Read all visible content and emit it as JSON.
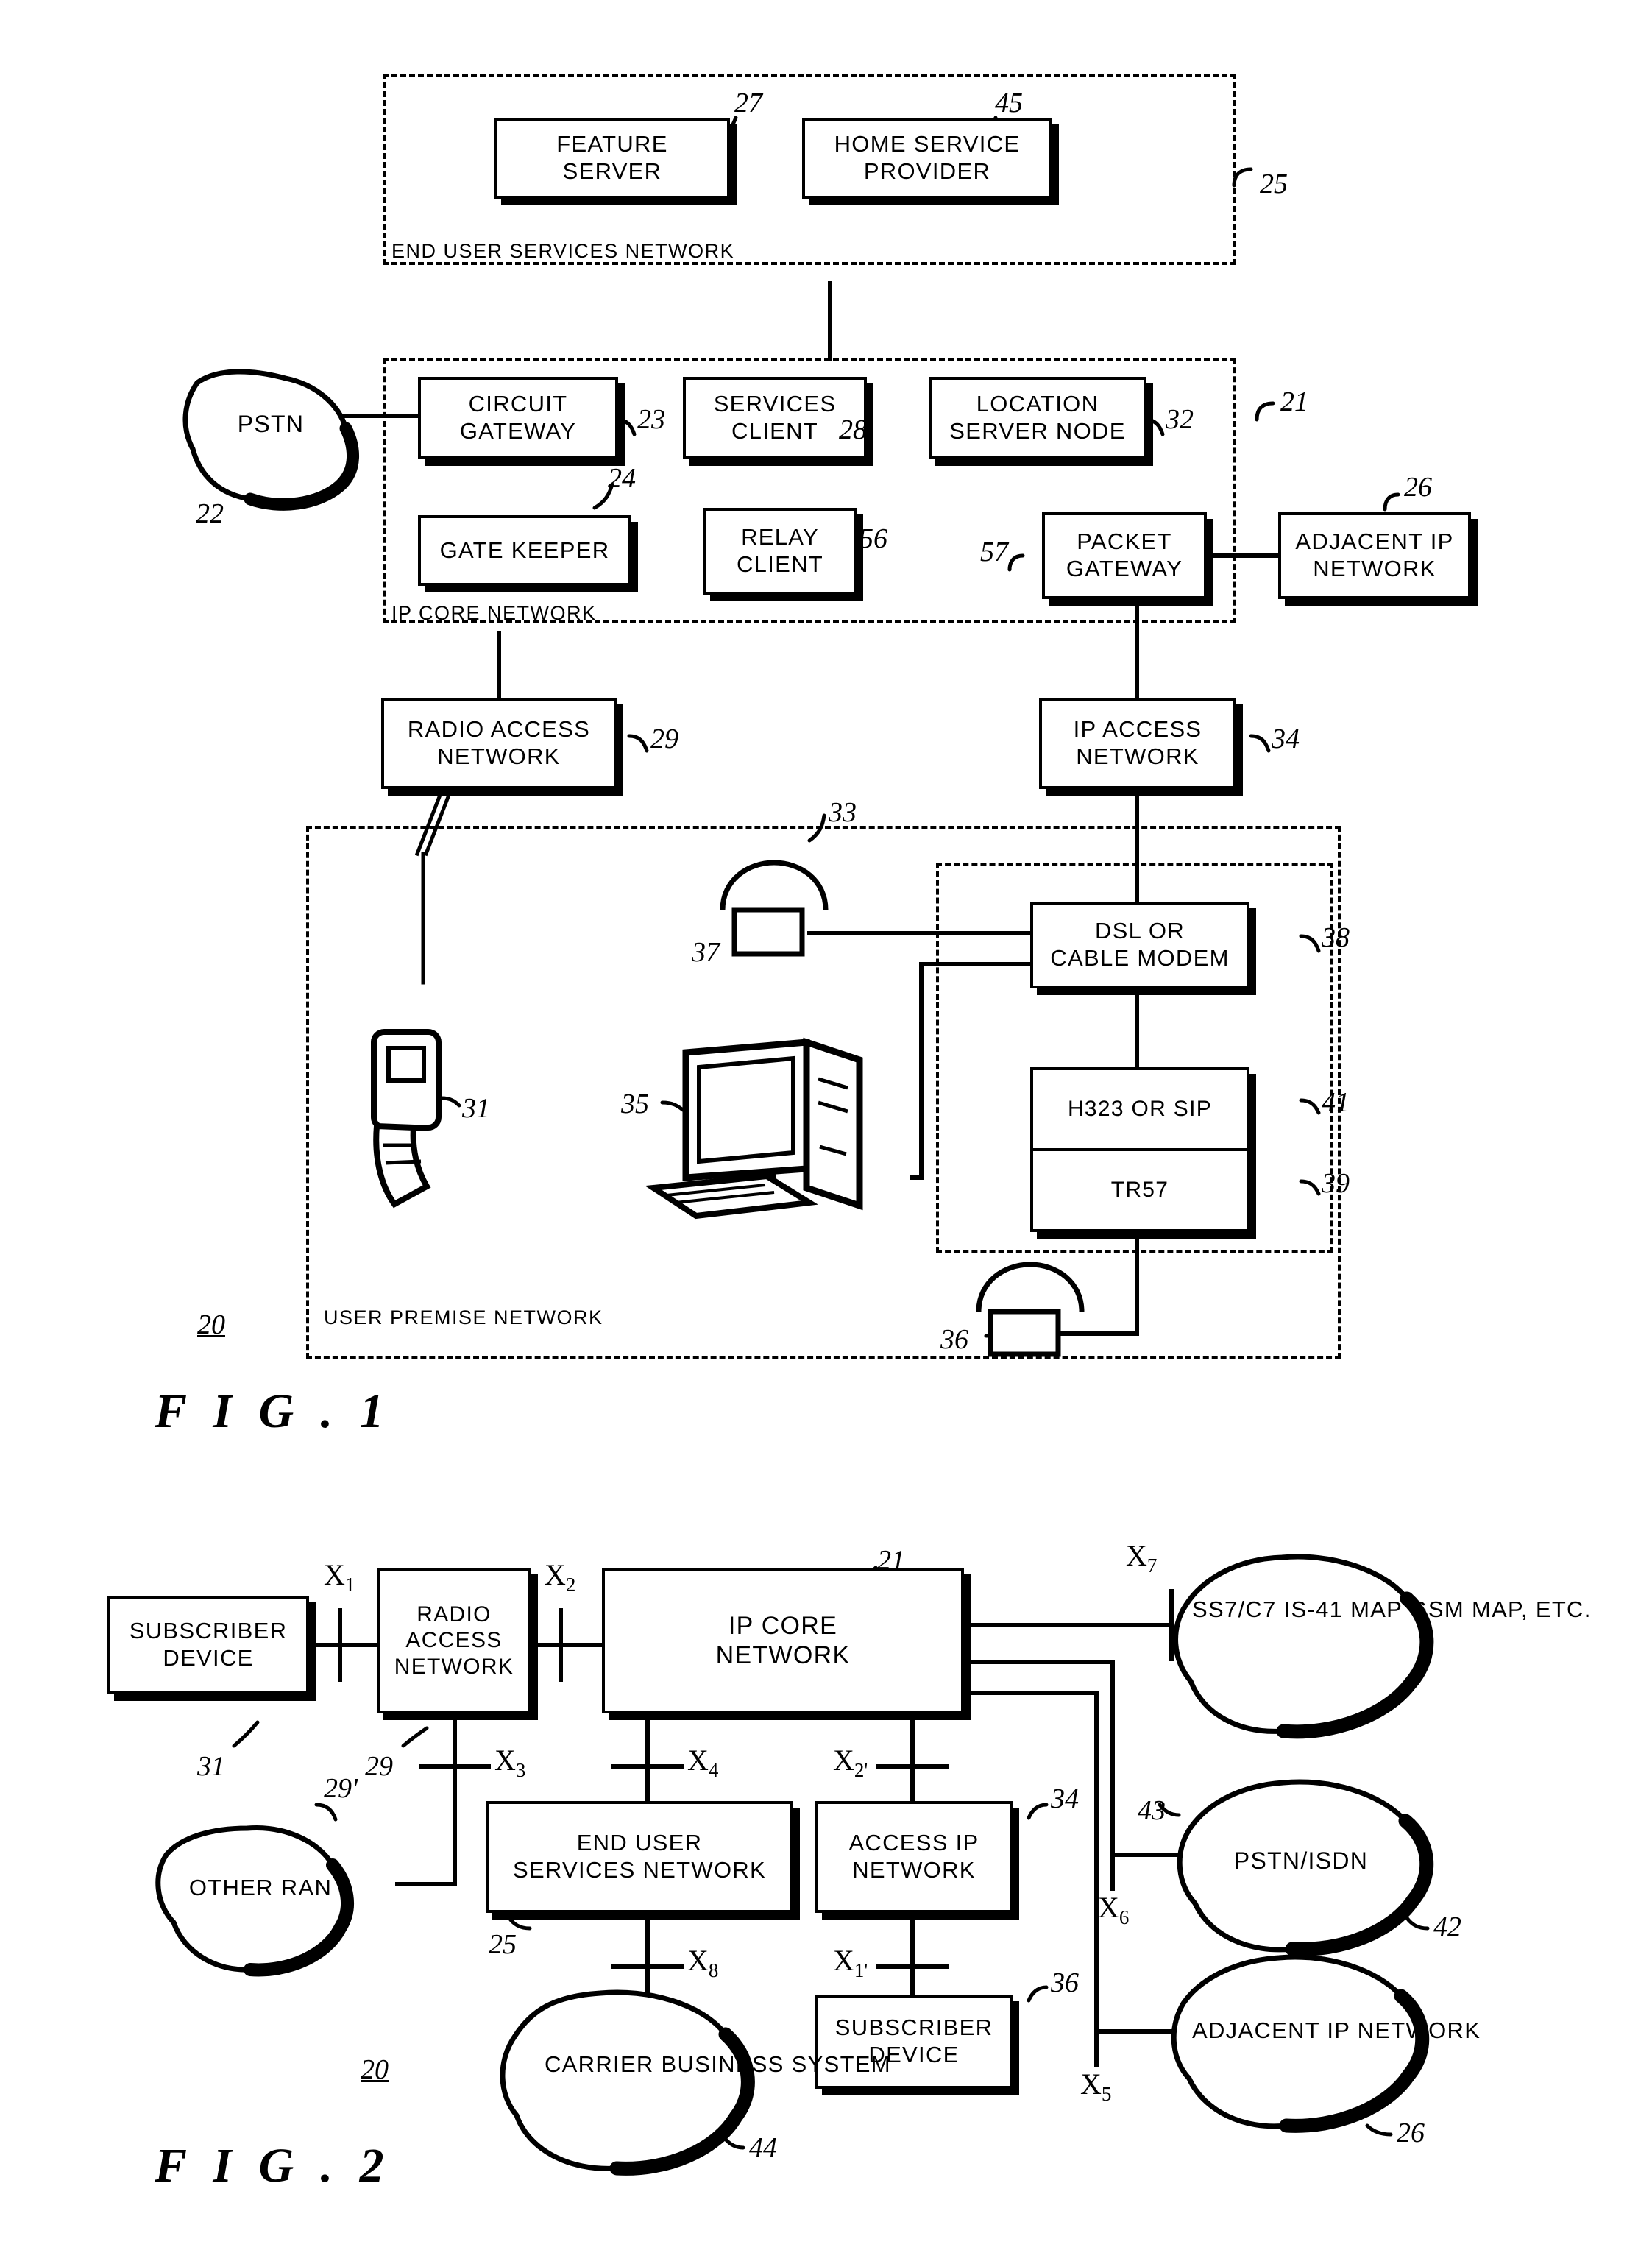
{
  "figure1": {
    "caption": "F I G .   1",
    "sheet_ref": "20",
    "regions": [
      {
        "label": "END USER SERVICES NETWORK",
        "ref": "25"
      },
      {
        "label": "IP CORE NETWORK",
        "ref": "21"
      },
      {
        "label": "USER PREMISE NETWORK",
        "ref": ""
      }
    ],
    "boxes": [
      {
        "id": "feature-server",
        "lines": [
          "FEATURE",
          "SERVER"
        ],
        "ref": "27"
      },
      {
        "id": "home-service",
        "lines": [
          "HOME SERVICE",
          "PROVIDER"
        ],
        "ref": "45"
      },
      {
        "id": "circuit-gateway",
        "lines": [
          "CIRCUIT",
          "GATEWAY"
        ],
        "ref": "23"
      },
      {
        "id": "services-client",
        "lines": [
          "SERVICES",
          "CLIENT"
        ],
        "ref": "28"
      },
      {
        "id": "location-server",
        "lines": [
          "LOCATION",
          "SERVER NODE"
        ],
        "ref": "32"
      },
      {
        "id": "gate-keeper",
        "lines": [
          "GATE KEEPER"
        ],
        "ref": "24"
      },
      {
        "id": "relay-client",
        "lines": [
          "RELAY",
          "CLIENT"
        ],
        "ref": "56"
      },
      {
        "id": "packet-gateway",
        "lines": [
          "PACKET",
          "GATEWAY"
        ],
        "ref": "57"
      },
      {
        "id": "adjacent-ip",
        "lines": [
          "ADJACENT IP",
          "NETWORK"
        ],
        "ref": "26"
      },
      {
        "id": "radio-access",
        "lines": [
          "RADIO ACCESS",
          "NETWORK"
        ],
        "ref": "29"
      },
      {
        "id": "ip-access",
        "lines": [
          "IP ACCESS",
          "NETWORK"
        ],
        "ref": "34"
      },
      {
        "id": "dsl-cable-modem",
        "lines": [
          "DSL OR",
          "CABLE MODEM"
        ],
        "ref": "38"
      }
    ],
    "stack_box": {
      "top": {
        "label": "H323 OR SIP",
        "ref": "41"
      },
      "bottom": {
        "label": "TR57",
        "ref": "39"
      }
    },
    "clouds": [
      {
        "id": "pstn",
        "lines": [
          "PSTN"
        ],
        "ref": "22"
      }
    ],
    "devices": [
      {
        "id": "telephone-upper",
        "ref": "37",
        "callout_ref": "33"
      },
      {
        "id": "telephone-lower",
        "ref": "36"
      },
      {
        "id": "mobile-handset",
        "ref": "31"
      },
      {
        "id": "computer",
        "ref": "35"
      }
    ]
  },
  "figure2": {
    "caption": "F I G .   2",
    "sheet_ref": "20",
    "boxes": [
      {
        "id": "subscriber-device-left",
        "lines": [
          "SUBSCRIBER",
          "DEVICE"
        ],
        "ref": "31"
      },
      {
        "id": "radio-access-network",
        "lines": [
          "RADIO",
          "ACCESS",
          "NETWORK"
        ],
        "ref": "29"
      },
      {
        "id": "ip-core-network",
        "lines": [
          "IP CORE",
          "NETWORK"
        ],
        "ref": "21"
      },
      {
        "id": "end-user-services",
        "lines": [
          "END USER",
          "SERVICES NETWORK"
        ],
        "ref": "25"
      },
      {
        "id": "access-ip-network",
        "lines": [
          "ACCESS IP",
          "NETWORK"
        ],
        "ref": "34"
      },
      {
        "id": "subscriber-device-right",
        "lines": [
          "SUBSCRIBER",
          "DEVICE"
        ],
        "ref": "36"
      }
    ],
    "clouds": [
      {
        "id": "other-ran",
        "lines": [
          "OTHER",
          "RAN"
        ],
        "ref": "29'"
      },
      {
        "id": "ss7-c7",
        "lines": [
          "SS7/C7",
          "IS-41 MAP",
          "GSM MAP, ETC."
        ],
        "ref": "43"
      },
      {
        "id": "pstn-isdn",
        "lines": [
          "PSTN/ISDN"
        ],
        "ref": "42"
      },
      {
        "id": "adjacent-ip-net",
        "lines": [
          "ADJACENT",
          "IP NETWORK"
        ],
        "ref": "26"
      },
      {
        "id": "carrier-business",
        "lines": [
          "CARRIER",
          "BUSINESS",
          "SYSTEM"
        ],
        "ref": "44"
      }
    ],
    "interfaces": [
      {
        "id": "x1",
        "base": "X",
        "sub": "1"
      },
      {
        "id": "x2",
        "base": "X",
        "sub": "2"
      },
      {
        "id": "x3",
        "base": "X",
        "sub": "3"
      },
      {
        "id": "x4",
        "base": "X",
        "sub": "4"
      },
      {
        "id": "x5",
        "base": "X",
        "sub": "5"
      },
      {
        "id": "x6",
        "base": "X",
        "sub": "6"
      },
      {
        "id": "x7",
        "base": "X",
        "sub": "7"
      },
      {
        "id": "x8",
        "base": "X",
        "sub": "8"
      },
      {
        "id": "x2p",
        "base": "X",
        "sub": "2'"
      },
      {
        "id": "x1p",
        "base": "X",
        "sub": "1'"
      }
    ]
  },
  "colors": {
    "ink": "#000000",
    "paper": "#ffffff"
  }
}
